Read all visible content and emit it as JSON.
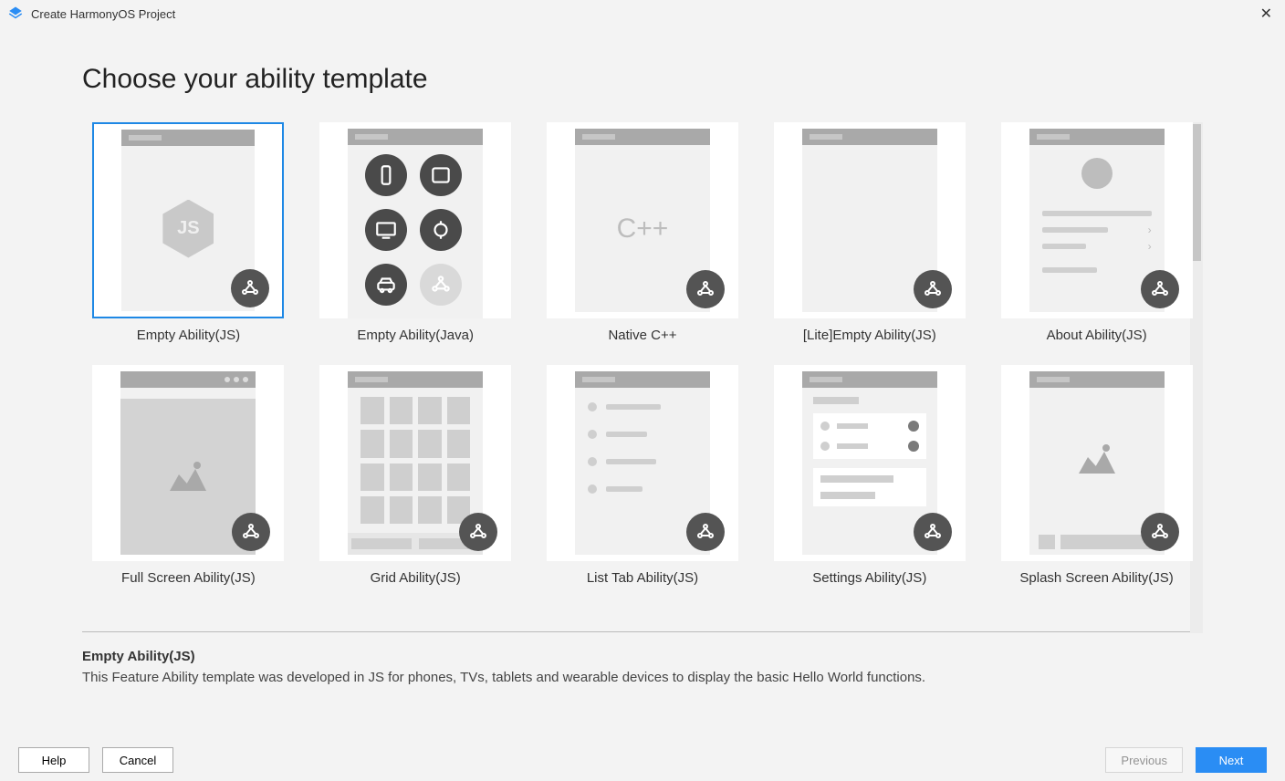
{
  "window": {
    "title": "Create HarmonyOS Project"
  },
  "heading": "Choose your ability template",
  "templates": [
    {
      "id": "empty-js",
      "label": "Empty Ability(JS)",
      "selected": true
    },
    {
      "id": "empty-java",
      "label": "Empty Ability(Java)",
      "selected": false
    },
    {
      "id": "native-cpp",
      "label": "Native C++",
      "selected": false
    },
    {
      "id": "lite-empty",
      "label": "[Lite]Empty Ability(JS)",
      "selected": false
    },
    {
      "id": "about",
      "label": "About Ability(JS)",
      "selected": false
    },
    {
      "id": "fullscreen",
      "label": "Full Screen Ability(JS)",
      "selected": false
    },
    {
      "id": "grid",
      "label": "Grid Ability(JS)",
      "selected": false
    },
    {
      "id": "listtab",
      "label": "List Tab Ability(JS)",
      "selected": false
    },
    {
      "id": "settings",
      "label": "Settings Ability(JS)",
      "selected": false
    },
    {
      "id": "splash",
      "label": "Splash Screen Ability(JS)",
      "selected": false
    }
  ],
  "description": {
    "title": "Empty Ability(JS)",
    "text": "This Feature Ability template was developed in JS for phones, TVs, tablets and wearable devices to display the basic Hello World functions."
  },
  "footer": {
    "help": "Help",
    "cancel": "Cancel",
    "previous": "Previous",
    "next": "Next"
  },
  "glyphs": {
    "cpp": "C++",
    "js": "JS"
  }
}
